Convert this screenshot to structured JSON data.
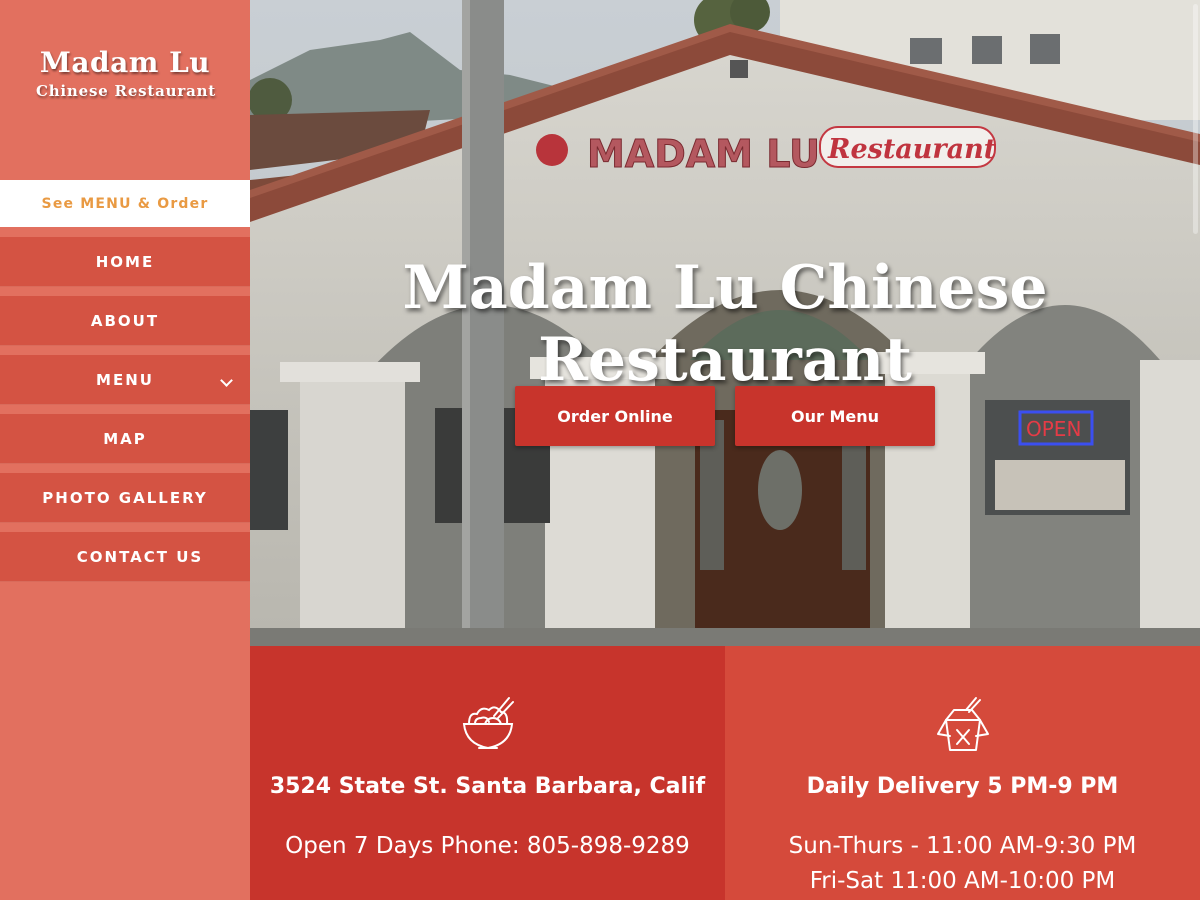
{
  "brand": {
    "name": "Madam Lu",
    "subtitle": "Chinese Restaurant"
  },
  "order_link": "See MENU & Order",
  "nav": [
    {
      "label": "HOME"
    },
    {
      "label": "ABOUT"
    },
    {
      "label": "MENU",
      "has_submenu": true
    },
    {
      "label": "MAP"
    },
    {
      "label": "PHOTO GALLERY"
    },
    {
      "label": "CONTACT US"
    }
  ],
  "hero": {
    "title": "Madam Lu Chinese Restaurant",
    "sign_name": "MADAM LU",
    "sign_restaurant": "Restaurant",
    "open_sign": "OPEN",
    "buttons": {
      "order": "Order Online",
      "menu": "Our Menu"
    }
  },
  "info": {
    "address": "3524 State St. Santa Barbara, Calif",
    "phone_line": "Open 7 Days Phone: 805-898-9289",
    "delivery": "Daily Delivery 5 PM-9 PM",
    "hours_weekday": "Sun-Thurs - 11:00 AM-9:30 PM",
    "hours_weekend": "Fri-Sat 11:00 AM-10:00 PM",
    "icons": {
      "left": "noodle-bowl-icon",
      "right": "takeout-box-icon"
    }
  },
  "colors": {
    "sidebar": "#e2705f",
    "nav_item": "#d45343",
    "accent_orange": "#e99a43",
    "button_red": "#c8342c",
    "panel_left": "#c7342c",
    "panel_right": "#d54a3b"
  }
}
